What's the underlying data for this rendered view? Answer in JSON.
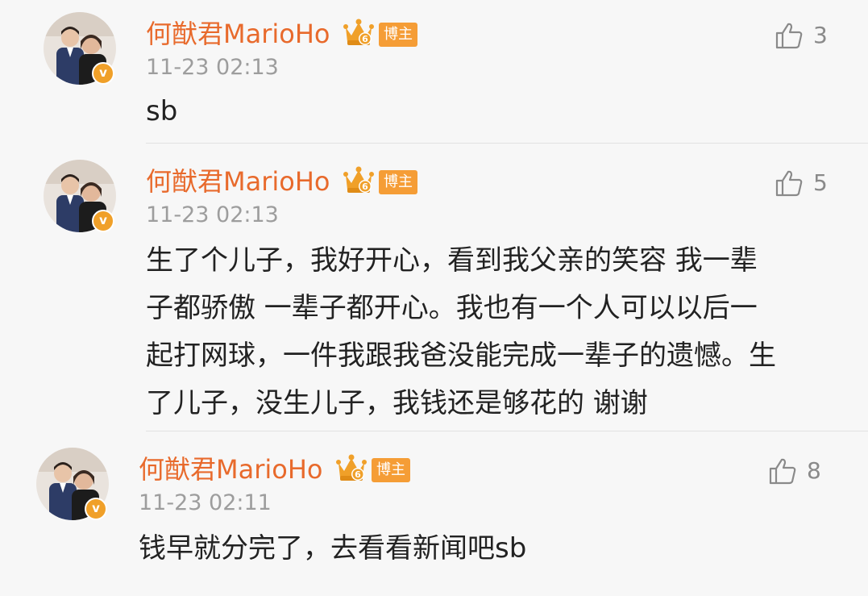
{
  "comments": [
    {
      "username": "何猷君MarioHo",
      "badge": "博主",
      "verified_mark": "v",
      "level": "6",
      "time": "11-23 02:13",
      "likes": "3",
      "lines": [
        "sb"
      ]
    },
    {
      "username": "何猷君MarioHo",
      "badge": "博主",
      "verified_mark": "v",
      "level": "6",
      "time": "11-23 02:13",
      "likes": "5",
      "lines": [
        "生了个儿子，我好开心，看到我父亲的笑容 我一辈",
        "子都骄傲 一辈子都开心。我也有一个人可以以后一",
        "起打网球，一件我跟我爸没能完成一辈子的遗憾。生",
        "了儿子，没生儿子，我钱还是够花的 谢谢"
      ]
    },
    {
      "username": "何猷君MarioHo",
      "badge": "博主",
      "verified_mark": "v",
      "level": "6",
      "time": "11-23 02:11",
      "likes": "8",
      "lines": [
        "钱早就分完了，去看看新闻吧sb"
      ]
    }
  ],
  "icons": {
    "like": "thumbs-up-icon",
    "crown": "crown-level-icon",
    "verified": "verified-v-icon"
  },
  "colors": {
    "username": "#e86a2c",
    "badge_bg": "#f59d36",
    "crown": "#f0a029",
    "timestamp": "#9d9d9d",
    "text": "#222222",
    "background": "#f7f7f7"
  }
}
